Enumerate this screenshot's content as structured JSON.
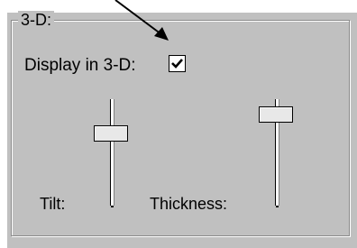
{
  "group": {
    "title": "3-D:"
  },
  "display3d": {
    "label": "Display in 3-D:",
    "checked": true
  },
  "sliders": {
    "tilt": {
      "label": "Tilt:"
    },
    "thickness": {
      "label": "Thickness:"
    }
  }
}
